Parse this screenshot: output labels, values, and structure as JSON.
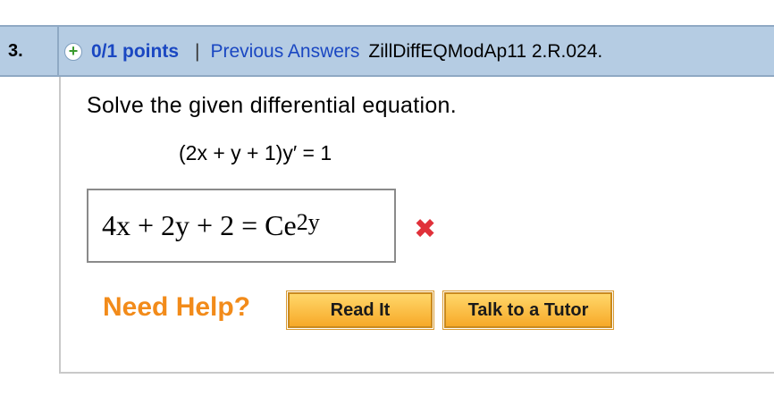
{
  "header": {
    "question_number": "3.",
    "points": "0/1 points",
    "separator": "|",
    "previous_answers": "Previous Answers",
    "question_id": "ZillDiffEQModAp11 2.R.024."
  },
  "question": {
    "instruction": "Solve the given differential equation.",
    "equation": "(2x + y + 1)y′ = 1"
  },
  "answer": {
    "lhs": "4x + 2y + 2 = Ce",
    "exponent": "2y",
    "status": "incorrect"
  },
  "help": {
    "label": "Need Help?",
    "read_button": "Read It",
    "tutor_button": "Talk to a Tutor"
  },
  "icons": {
    "expand": "plus-icon",
    "incorrect": "x-icon"
  },
  "colors": {
    "header_bg": "#b5cce3",
    "link": "#1a47c2",
    "help": "#f28b1a",
    "incorrect": "#e0313a",
    "button": "#f7a928"
  }
}
